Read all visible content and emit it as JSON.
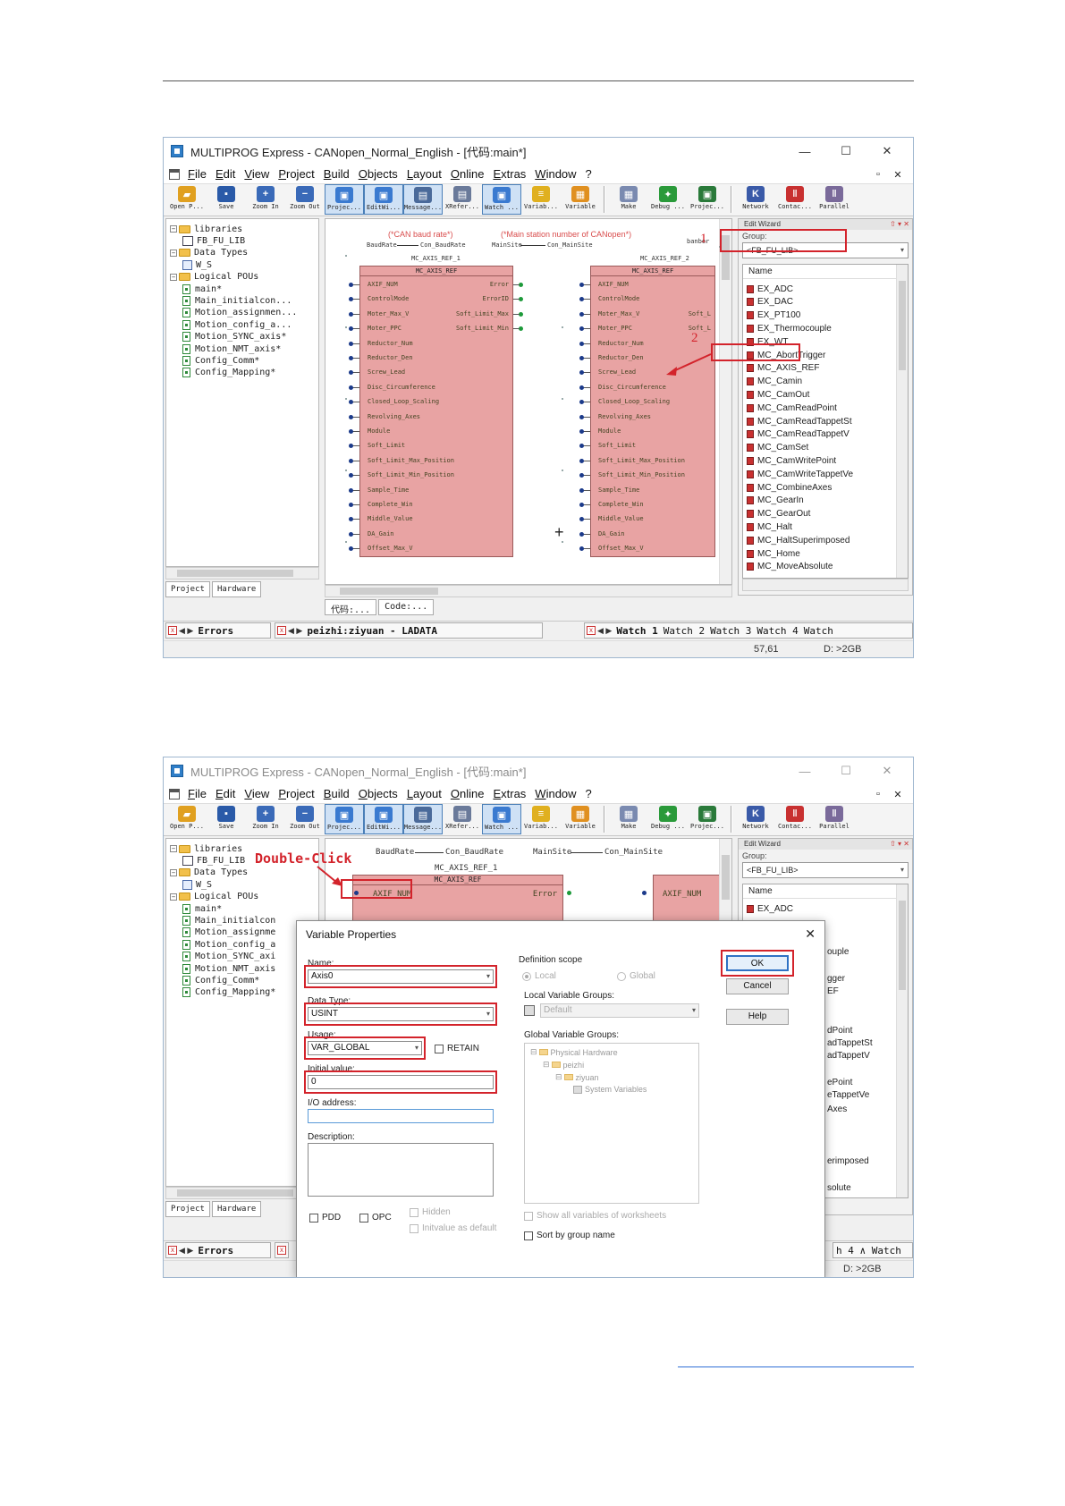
{
  "window": {
    "title": "MULTIPROG Express - CANopen_Normal_English - [代码:main*]",
    "controls": {
      "minimize": "—",
      "maximize": "☐",
      "close": "✕"
    }
  },
  "menu": [
    "File",
    "Edit",
    "View",
    "Project",
    "Build",
    "Objects",
    "Layout",
    "Online",
    "Extras",
    "Window",
    "?"
  ],
  "mdi_controls": {
    "restore": "▫",
    "close": "✕"
  },
  "toolbar": [
    {
      "label": "Open P...",
      "icon": "open-folder-icon",
      "color": "#e0a020",
      "glyph": "▰"
    },
    {
      "label": "Save",
      "icon": "save-icon",
      "color": "#2a5aa8",
      "glyph": "▪"
    },
    {
      "label": "Zoom In",
      "icon": "zoom-in-icon",
      "color": "#3a6ab8",
      "glyph": "+"
    },
    {
      "label": "Zoom Out",
      "icon": "zoom-out-icon",
      "color": "#3a6ab8",
      "glyph": "−"
    },
    {
      "label": "Projec...",
      "icon": "project-window-icon",
      "color": "#3a7ad0",
      "glyph": "▣",
      "pressed": true
    },
    {
      "label": "EditWi...",
      "icon": "edit-wizard-icon",
      "color": "#3a7ad0",
      "glyph": "▣",
      "pressed": true
    },
    {
      "label": "Message...",
      "icon": "message-window-icon",
      "color": "#4a6a9a",
      "glyph": "▤",
      "pressed": true
    },
    {
      "label": "XRefer...",
      "icon": "cross-reference-icon",
      "color": "#6a7a9a",
      "glyph": "▤"
    },
    {
      "label": "Watch ...",
      "icon": "watch-window-icon",
      "color": "#3a7ad0",
      "glyph": "▣",
      "pressed": true
    },
    {
      "label": "Variab...",
      "icon": "variables-icon",
      "color": "#e0b020",
      "glyph": "≡"
    },
    {
      "label": "Variable",
      "icon": "variable-icon",
      "color": "#e09020",
      "glyph": "▦"
    },
    {
      "sep": true
    },
    {
      "label": "Make",
      "icon": "make-icon",
      "color": "#7a8ab0",
      "glyph": "▦"
    },
    {
      "label": "Debug ...",
      "icon": "debug-icon",
      "color": "#2a9a3a",
      "glyph": "✦"
    },
    {
      "label": "Projec...",
      "icon": "project-control-icon",
      "color": "#2a7a3a",
      "glyph": "▣"
    },
    {
      "sep": true
    },
    {
      "label": "Network",
      "icon": "network-icon",
      "color": "#3a5aa8",
      "glyph": "K"
    },
    {
      "label": "Contac...",
      "icon": "contact-icon",
      "color": "#c83030",
      "glyph": "‖"
    },
    {
      "label": "Parallel",
      "icon": "parallel-icon",
      "color": "#7a6a9a",
      "glyph": "‖"
    }
  ],
  "tree": {
    "items": [
      {
        "label": "libraries",
        "type": "folder",
        "depth": 0,
        "exp": "−"
      },
      {
        "label": "FB_FU_LIB",
        "type": "lib",
        "depth": 1
      },
      {
        "label": "Data Types",
        "type": "folder",
        "depth": 0,
        "exp": "−"
      },
      {
        "label": "W_S",
        "type": "type",
        "depth": 1
      },
      {
        "label": "Logical POUs",
        "type": "folder",
        "depth": 0,
        "exp": "−"
      },
      {
        "label": "main*",
        "type": "doc",
        "depth": 1
      },
      {
        "label": "Main_initialcon...",
        "type": "doc",
        "depth": 1
      },
      {
        "label": "Motion_assignmen...",
        "type": "doc",
        "depth": 1
      },
      {
        "label": "Motion_config_a...",
        "type": "doc",
        "depth": 1
      },
      {
        "label": "Motion_SYNC_axis*",
        "type": "doc",
        "depth": 1
      },
      {
        "label": "Motion_NMT_axis*",
        "type": "doc",
        "depth": 1
      },
      {
        "label": "Config_Comm*",
        "type": "doc",
        "depth": 1
      },
      {
        "label": "Config_Mapping*",
        "type": "doc",
        "depth": 1
      }
    ],
    "tabs": [
      "Project",
      "Hardware"
    ]
  },
  "tree2_items": [
    "libraries",
    "FB_FU_LIB",
    "Data Types",
    "W_S",
    "Logical POUs",
    "main*",
    "Main_initialcon",
    "Motion_assignme",
    "Motion_config_a",
    "Motion_SYNC_axi",
    "Motion_NMT_axis",
    "Config_Comm*",
    "Config_Mapping*"
  ],
  "editor": {
    "comments": {
      "baud": "(*CAN baud rate*)",
      "station": "(*Main station number of CANopen*)"
    },
    "signals": {
      "baud_in": "BaudRate",
      "baud_var": "Con_BaudRate",
      "station_in": "MainSite",
      "station_var": "Con_MainSite",
      "truncated": "banber"
    },
    "instance_1": "MC_AXIS_REF_1",
    "instance_2": "MC_AXIS_REF_2",
    "fb_type": "MC_AXIS_REF",
    "inputs": [
      "AXIF_NUM",
      "ControlMode",
      "Moter_Max_V",
      "Moter_PPC",
      "Reductor_Num",
      "Reductor_Den",
      "Screw_Lead",
      "Disc_Circumference",
      "Closed_Loop_Scaling",
      "Revolving_Axes",
      "Module",
      "Soft_Limit",
      "Soft_Limit_Max_Position",
      "Soft_Limit_Min_Position",
      "Sample_Time",
      "Complete_Win",
      "Middle_Value",
      "DA_Gain",
      "Offset_Max_V"
    ],
    "outputs": [
      "Error",
      "ErrorID",
      "Soft_Limit_Max",
      "Soft_Limit_Min"
    ],
    "outputs_2": [
      "Soft_L",
      "Soft_L"
    ],
    "cursor": "+",
    "tabs": [
      "代码:...",
      "Code:..."
    ]
  },
  "editor2": {
    "baud_in": "BaudRate",
    "baud_var": "Con_BaudRate",
    "station_in": "MainSite",
    "station_var": "Con_MainSite",
    "instance": "MC_AXIS_REF_1",
    "fb_type": "MC_AXIS_REF",
    "axif": "AXIF_NUM",
    "error": "Error",
    "axif_2": "AXIF_NUM"
  },
  "wizard": {
    "title": "Edit Wizard",
    "title_ctrls": "⇧ ▾ ✕",
    "group_label": "Group:",
    "group_value": "<FB_FU_LIB>",
    "list_header": "Name",
    "items": [
      "EX_ADC",
      "EX_DAC",
      "EX_PT100",
      "EX_Thermocouple",
      "EX_WT",
      "MC_AbortTrigger",
      "MC_AXIS_REF",
      "MC_Camin",
      "MC_CamOut",
      "MC_CamReadPoint",
      "MC_CamReadTappetSt",
      "MC_CamReadTappetV",
      "MC_CamSet",
      "MC_CamWritePoint",
      "MC_CamWriteTappetVe",
      "MC_CombineAxes",
      "MC_GearIn",
      "MC_GearOut",
      "MC_Halt",
      "MC_HaltSuperimposed",
      "MC_Home",
      "MC_MoveAbsolute"
    ],
    "items2": [
      "EX_ADC"
    ],
    "fragments2": [
      "ouple",
      "gger",
      "EF",
      "dPoint",
      "adTappetSt",
      "adTappetV",
      "ePoint",
      "eTappetVe",
      "Axes",
      "erimposed",
      "solute"
    ]
  },
  "messages": {
    "errors_tab": "Errors",
    "log_text": "peizhi:ziyuan - LADATA",
    "watch_tabs": [
      "Watch 1",
      "Watch 2",
      "Watch 3",
      "Watch 4",
      "Watch"
    ],
    "watch2_text": "h 4 ∧ Watch"
  },
  "status": {
    "position": "57,61",
    "disk": "D: >2GB"
  },
  "annotations": {
    "one": "1",
    "two": "2",
    "double_click": "Double-Click"
  },
  "dialog": {
    "title": "Variable Properties",
    "name_label": "Name:",
    "name_value": "Axis0",
    "datatype_label": "Data Type:",
    "datatype_value": "USINT",
    "usage_label": "Usage:",
    "usage_value": "VAR_GLOBAL",
    "retain_label": "RETAIN",
    "initial_label": "Initial value:",
    "initial_value": "0",
    "io_label": "I/O address:",
    "desc_label": "Description:",
    "pdd_label": "PDD",
    "opc_label": "OPC",
    "hidden_label": "Hidden",
    "initdefault_label": "Initvalue as default",
    "scope_label": "Definition scope",
    "local_label": "Local",
    "global_label": "Global",
    "lvg_label": "Local Variable Groups:",
    "lvg_value": "Default",
    "gvg_label": "Global Variable Groups:",
    "gvg_tree": [
      "Physical Hardware",
      "peizhi",
      "ziyuan",
      "System Variables"
    ],
    "show_all_label": "Show all variables of worksheets",
    "sort_label": "Sort by group name",
    "ok": "OK",
    "cancel": "Cancel",
    "help": "Help"
  }
}
